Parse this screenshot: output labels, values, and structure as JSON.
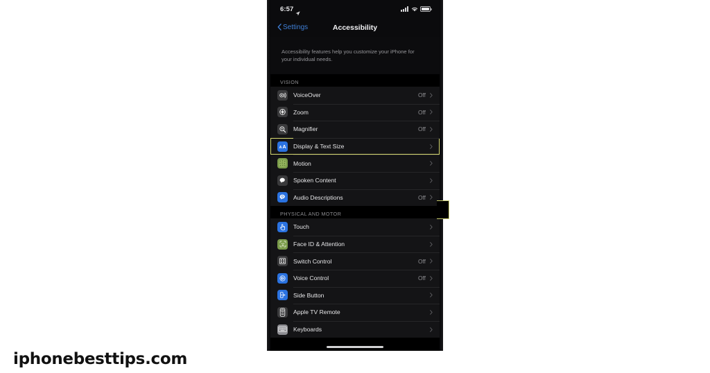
{
  "watermark": {
    "text": "iphonebesttips.com"
  },
  "phone": {
    "status_bar": {
      "time": "6:57",
      "location_icon": "location-arrow-icon",
      "cellular_icon": "cellular-bars-icon",
      "wifi_icon": "wifi-icon",
      "battery_icon": "battery-icon"
    },
    "nav_bar": {
      "back_label": "Settings",
      "back_icon": "chevron-left-icon",
      "title": "Accessibility"
    },
    "intro": {
      "text": "Accessibility features help you customize your iPhone for your individual needs."
    },
    "sections": [
      {
        "header": "VISION",
        "rows": [
          {
            "label": "VoiceOver",
            "value": "Off",
            "icon": "voiceover-icon",
            "icon_color": "gray"
          },
          {
            "label": "Zoom",
            "value": "Off",
            "icon": "zoom-icon",
            "icon_color": "gray"
          },
          {
            "label": "Magnifier",
            "value": "Off",
            "icon": "magnifier-icon",
            "icon_color": "gray"
          },
          {
            "label": "Display & Text Size",
            "value": "",
            "icon": "display-text-size-icon",
            "icon_color": "blue",
            "highlighted": true
          },
          {
            "label": "Motion",
            "value": "",
            "icon": "motion-icon",
            "icon_color": "green"
          },
          {
            "label": "Spoken Content",
            "value": "",
            "icon": "spoken-content-icon",
            "icon_color": "gray"
          },
          {
            "label": "Audio Descriptions",
            "value": "Off",
            "icon": "audio-descriptions-icon",
            "icon_color": "blue"
          }
        ]
      },
      {
        "header": "PHYSICAL AND MOTOR",
        "rows": [
          {
            "label": "Touch",
            "value": "",
            "icon": "touch-icon",
            "icon_color": "blue"
          },
          {
            "label": "Face ID & Attention",
            "value": "",
            "icon": "face-id-icon",
            "icon_color": "green"
          },
          {
            "label": "Switch Control",
            "value": "Off",
            "icon": "switch-control-icon",
            "icon_color": "gray"
          },
          {
            "label": "Voice Control",
            "value": "Off",
            "icon": "voice-control-icon",
            "icon_color": "blue"
          },
          {
            "label": "Side Button",
            "value": "",
            "icon": "side-button-icon",
            "icon_color": "blue"
          },
          {
            "label": "Apple TV Remote",
            "value": "",
            "icon": "apple-tv-remote-icon",
            "icon_color": "gray"
          },
          {
            "label": "Keyboards",
            "value": "",
            "icon": "keyboards-icon",
            "icon_color": "lgray"
          }
        ]
      }
    ],
    "highlight_color": "#d8db72",
    "accent_color": "#3f7fd6"
  }
}
